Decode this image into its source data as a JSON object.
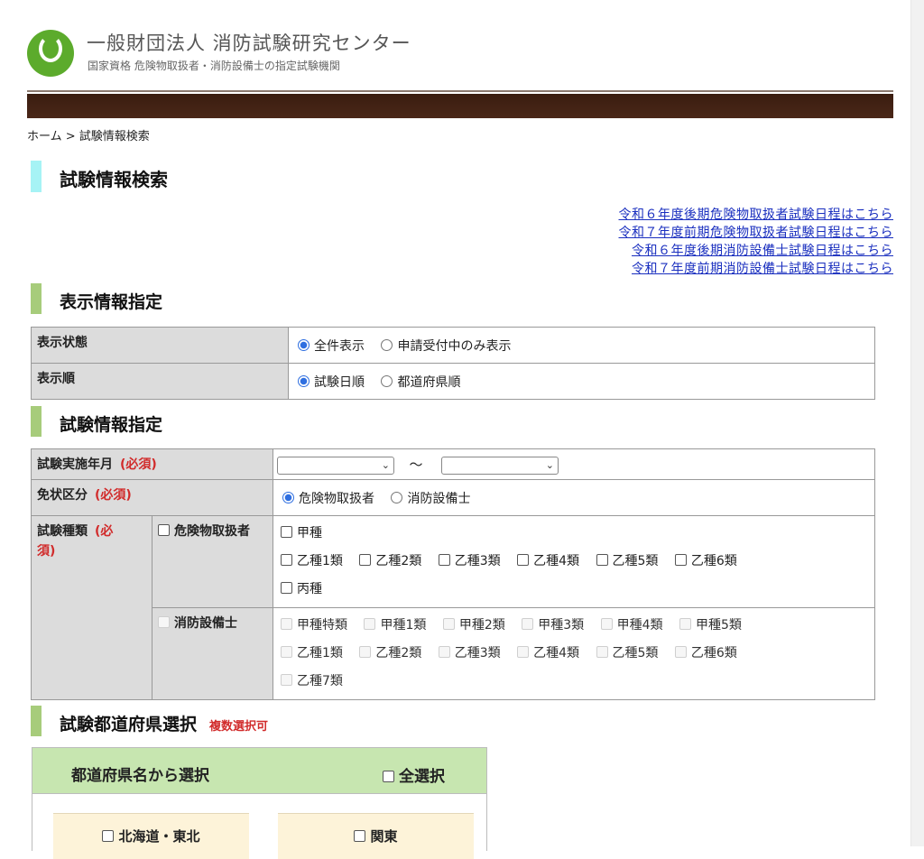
{
  "header": {
    "org_name": "一般財団法人 消防試験研究センター",
    "org_sub": "国家資格 危険物取扱者・消防設備士の指定試験機関"
  },
  "breadcrumb": "ホーム > 試験情報検索",
  "page_title": "試験情報検索",
  "schedule_links": [
    "令和６年度後期危険物取扱者試験日程はこちら",
    "令和７年度前期危険物取扱者試験日程はこちら",
    "令和６年度後期消防設備士試験日程はこちら",
    "令和７年度前期消防設備士試験日程はこちら"
  ],
  "display_section": {
    "title": "表示情報指定",
    "status_label": "表示状態",
    "status_options": [
      "全件表示",
      "申請受付中のみ表示"
    ],
    "status_selected": "全件表示",
    "order_label": "表示順",
    "order_options": [
      "試験日順",
      "都道府県順"
    ],
    "order_selected": "試験日順"
  },
  "exam_section": {
    "title": "試験情報指定",
    "required": "(必須)",
    "year_month_label": "試験実施年月",
    "range_sep": "〜",
    "license_label": "免状区分",
    "license_options": [
      "危険物取扱者",
      "消防設備士"
    ],
    "license_selected": "危険物取扱者",
    "type_label": "試験種類",
    "type_required_1": "(必",
    "type_required_2": "須)",
    "hazmat_label": "危険物取扱者",
    "hazmat_row1": [
      "甲種"
    ],
    "hazmat_row2": [
      "乙種1類",
      "乙種2類",
      "乙種3類",
      "乙種4類",
      "乙種5類",
      "乙種6類"
    ],
    "hazmat_row3": [
      "丙種"
    ],
    "fire_label": "消防設備士",
    "fire_row1": [
      "甲種特類",
      "甲種1類",
      "甲種2類",
      "甲種3類",
      "甲種4類",
      "甲種5類"
    ],
    "fire_row2": [
      "乙種1類",
      "乙種2類",
      "乙種3類",
      "乙種4類",
      "乙種5類",
      "乙種6類"
    ],
    "fire_row3": [
      "乙種7類"
    ]
  },
  "pref_section": {
    "title": "試験都道府県選択",
    "note": "複数選択可",
    "box_title": "都道府県名から選択",
    "select_all": "全選択",
    "regions": [
      "北海道・東北",
      "関東"
    ]
  }
}
